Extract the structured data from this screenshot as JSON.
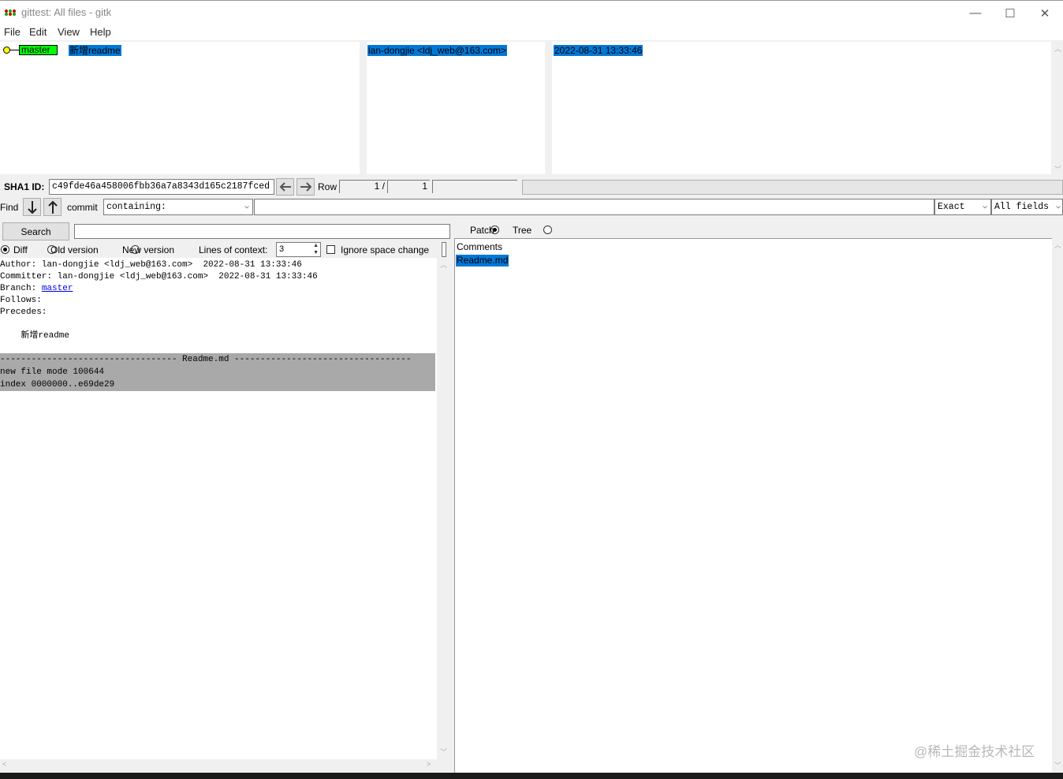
{
  "window": {
    "title": "gittest: All files - gitk",
    "minimize": "—",
    "maximize": "☐",
    "close": "✕"
  },
  "menu": [
    "File",
    "Edit",
    "View",
    "Help"
  ],
  "commits": [
    {
      "branch": "master",
      "message": "新增readme",
      "author": "lan-dongjie <ldj_web@163.com>",
      "date": "2022-08-31 13:33:46"
    }
  ],
  "sha1": {
    "label": "SHA1 ID:",
    "value": "c49fde46a458006fbb36a7a8343d165c2187fced",
    "row_label": "Row",
    "row_current": "1 /",
    "row_total": "1"
  },
  "find": {
    "label": "Find",
    "type": "commit",
    "mode": "containing:",
    "value": "",
    "match": "Exact",
    "fields": "All fields"
  },
  "search": {
    "button": "Search",
    "value": ""
  },
  "diff_options": {
    "diff": "Diff",
    "old_version": "Old version",
    "new_version": "New version",
    "lines_of_context_label": "Lines of context:",
    "lines_of_context": "3",
    "ignore_space": "Ignore space change"
  },
  "details": {
    "author": "Author: lan-dongjie <ldj_web@163.com>  2022-08-31 13:33:46",
    "committer": "Committer: lan-dongjie <ldj_web@163.com>  2022-08-31 13:33:46",
    "branch_label": "Branch: ",
    "branch_link": "master",
    "follows": "Follows:",
    "precedes": "Precedes:",
    "message": "    新增readme",
    "file_header": "---------------------------------- Readme.md ----------------------------------",
    "file_mode": "new file mode 100644",
    "index": "index 0000000..e69de29"
  },
  "file_list": {
    "patch": "Patch",
    "tree": "Tree",
    "items": [
      "Comments",
      "Readme.md"
    ]
  },
  "watermark": "@稀土掘金技术社区",
  "colors": {
    "selection": "#0078d7",
    "branch_tag": "#00ff00",
    "diff_header_bg": "#a9a9a9",
    "link": "#0000ee"
  }
}
